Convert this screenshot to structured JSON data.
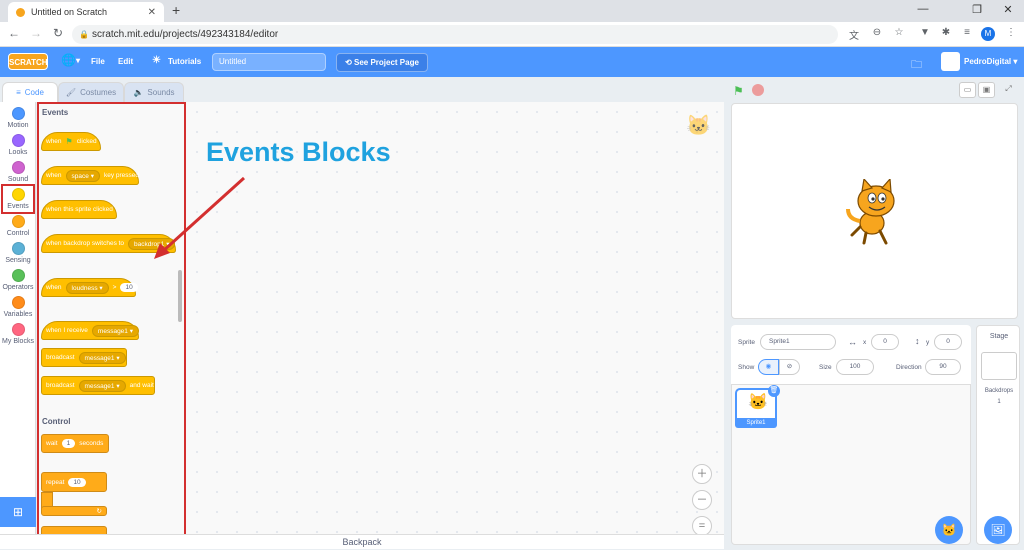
{
  "browser": {
    "tab_title": "Untitled on Scratch",
    "url": "scratch.mit.edu/projects/492343184/editor",
    "profile_initial": "M"
  },
  "menubar": {
    "logo": "SCRATCH",
    "file": "File",
    "edit": "Edit",
    "tutorials": "Tutorials",
    "project_title": "Untitled",
    "see_project_page": "See Project Page",
    "username": "PedroDigital"
  },
  "editor_tabs": {
    "code": "Code",
    "costumes": "Costumes",
    "sounds": "Sounds"
  },
  "categories": [
    {
      "label": "Motion",
      "color": "#4c97ff"
    },
    {
      "label": "Looks",
      "color": "#9966ff"
    },
    {
      "label": "Sound",
      "color": "#cf63cf"
    },
    {
      "label": "Events",
      "color": "#ffd500"
    },
    {
      "label": "Control",
      "color": "#ffab19"
    },
    {
      "label": "Sensing",
      "color": "#5cb1d6"
    },
    {
      "label": "Operators",
      "color": "#59c059"
    },
    {
      "label": "Variables",
      "color": "#ff8c1a"
    },
    {
      "label": "My Blocks",
      "color": "#ff6680"
    }
  ],
  "palette": {
    "events_heading": "Events",
    "control_heading": "Control",
    "when_flag_when": "when",
    "when_flag_clicked": "clicked",
    "when_key_when": "when",
    "when_key_key": "space",
    "when_key_pressed": "key pressed",
    "sprite_clicked": "when this sprite clicked",
    "backdrop_text": "when backdrop switches to",
    "backdrop_value": "backdrop1",
    "loudness_when": "when",
    "loudness_value": "loudness",
    "loudness_gt": ">",
    "loudness_num": "10",
    "receive_text": "when I receive",
    "receive_value": "message1",
    "broadcast_text": "broadcast",
    "broadcast_value": "message1",
    "broadcast_wait_text": "broadcast",
    "broadcast_wait_value": "message1",
    "broadcast_wait_suffix": "and wait",
    "wait_text": "wait",
    "wait_num": "1",
    "wait_suffix": "seconds",
    "repeat_text": "repeat",
    "repeat_num": "10"
  },
  "annotation": "Events Blocks",
  "backpack": "Backpack",
  "sprite_info": {
    "sprite_label": "Sprite",
    "sprite_name": "Sprite1",
    "x_label": "x",
    "x_value": "0",
    "y_label": "y",
    "y_value": "0",
    "show_label": "Show",
    "size_label": "Size",
    "size_value": "100",
    "direction_label": "Direction",
    "direction_value": "90"
  },
  "sprite_tile": "Sprite1",
  "stage_pane": {
    "title": "Stage",
    "backdrops_label": "Backdrops",
    "backdrops_count": "1"
  }
}
